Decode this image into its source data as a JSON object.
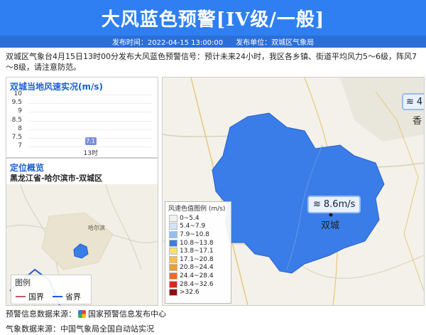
{
  "header": {
    "title": "大风蓝色预警[IV级/一般]"
  },
  "meta": {
    "time_label": "发布时间：2022-04-15 13:00:00",
    "unit_label": "发布单位：双城区气象局"
  },
  "notice": "双城区气象台4月15日13时00分发布大风蓝色预警信号：预计未来24小时，我区各乡镇、街道平均风力5～6级，阵风7～8级，请注意防范。",
  "wind_panel": {
    "title": "双城当地风速实况(m/s)",
    "chart_data": {
      "type": "bar",
      "categories": [
        "13时"
      ],
      "values": [
        7.1
      ],
      "ylim": [
        7,
        10
      ],
      "yticks": [
        "10",
        "9.5",
        "9",
        "8.5",
        "8",
        "7.5",
        "7"
      ]
    }
  },
  "location_panel": {
    "title": "定位概览",
    "text": "黑龙江省-哈尔滨市-双城区",
    "map_labels": {
      "city": "哈尔滨"
    },
    "legend_title": "图例",
    "legend_items": [
      {
        "label": "国界",
        "color": "#c0596b"
      },
      {
        "label": "省界",
        "color": "#1c5be0"
      }
    ]
  },
  "main_map": {
    "wind_badge": "8.6m/s",
    "district_label": "双城",
    "edge_badge": "4",
    "edge_text": "香",
    "district_color": "#3a7de8",
    "legend_title": "风速色值图例 (m/s)",
    "legend_items": [
      {
        "label": "0~5.4",
        "color": "#f0f0f0"
      },
      {
        "label": "5.4~7.9",
        "color": "#cfe3fb"
      },
      {
        "label": "7.9~10.8",
        "color": "#8fc1f5"
      },
      {
        "label": "10.8~13.8",
        "color": "#3a7de8"
      },
      {
        "label": "13.8~17.1",
        "color": "#f5e46a"
      },
      {
        "label": "17.1~20.8",
        "color": "#f7c23d"
      },
      {
        "label": "20.8~24.4",
        "color": "#f59a2d"
      },
      {
        "label": "24.4~28.4",
        "color": "#ef6a28"
      },
      {
        "label": "28.4~32.6",
        "color": "#d62a1e"
      },
      {
        "label": ">32.6",
        "color": "#8e0f12"
      }
    ]
  },
  "footer": {
    "warning_source": "预警信息数据来源：",
    "warning_source_org": "国家预警信息发布中心",
    "weather_source": "气象数据来源：中国气象局全国自动站实况"
  }
}
